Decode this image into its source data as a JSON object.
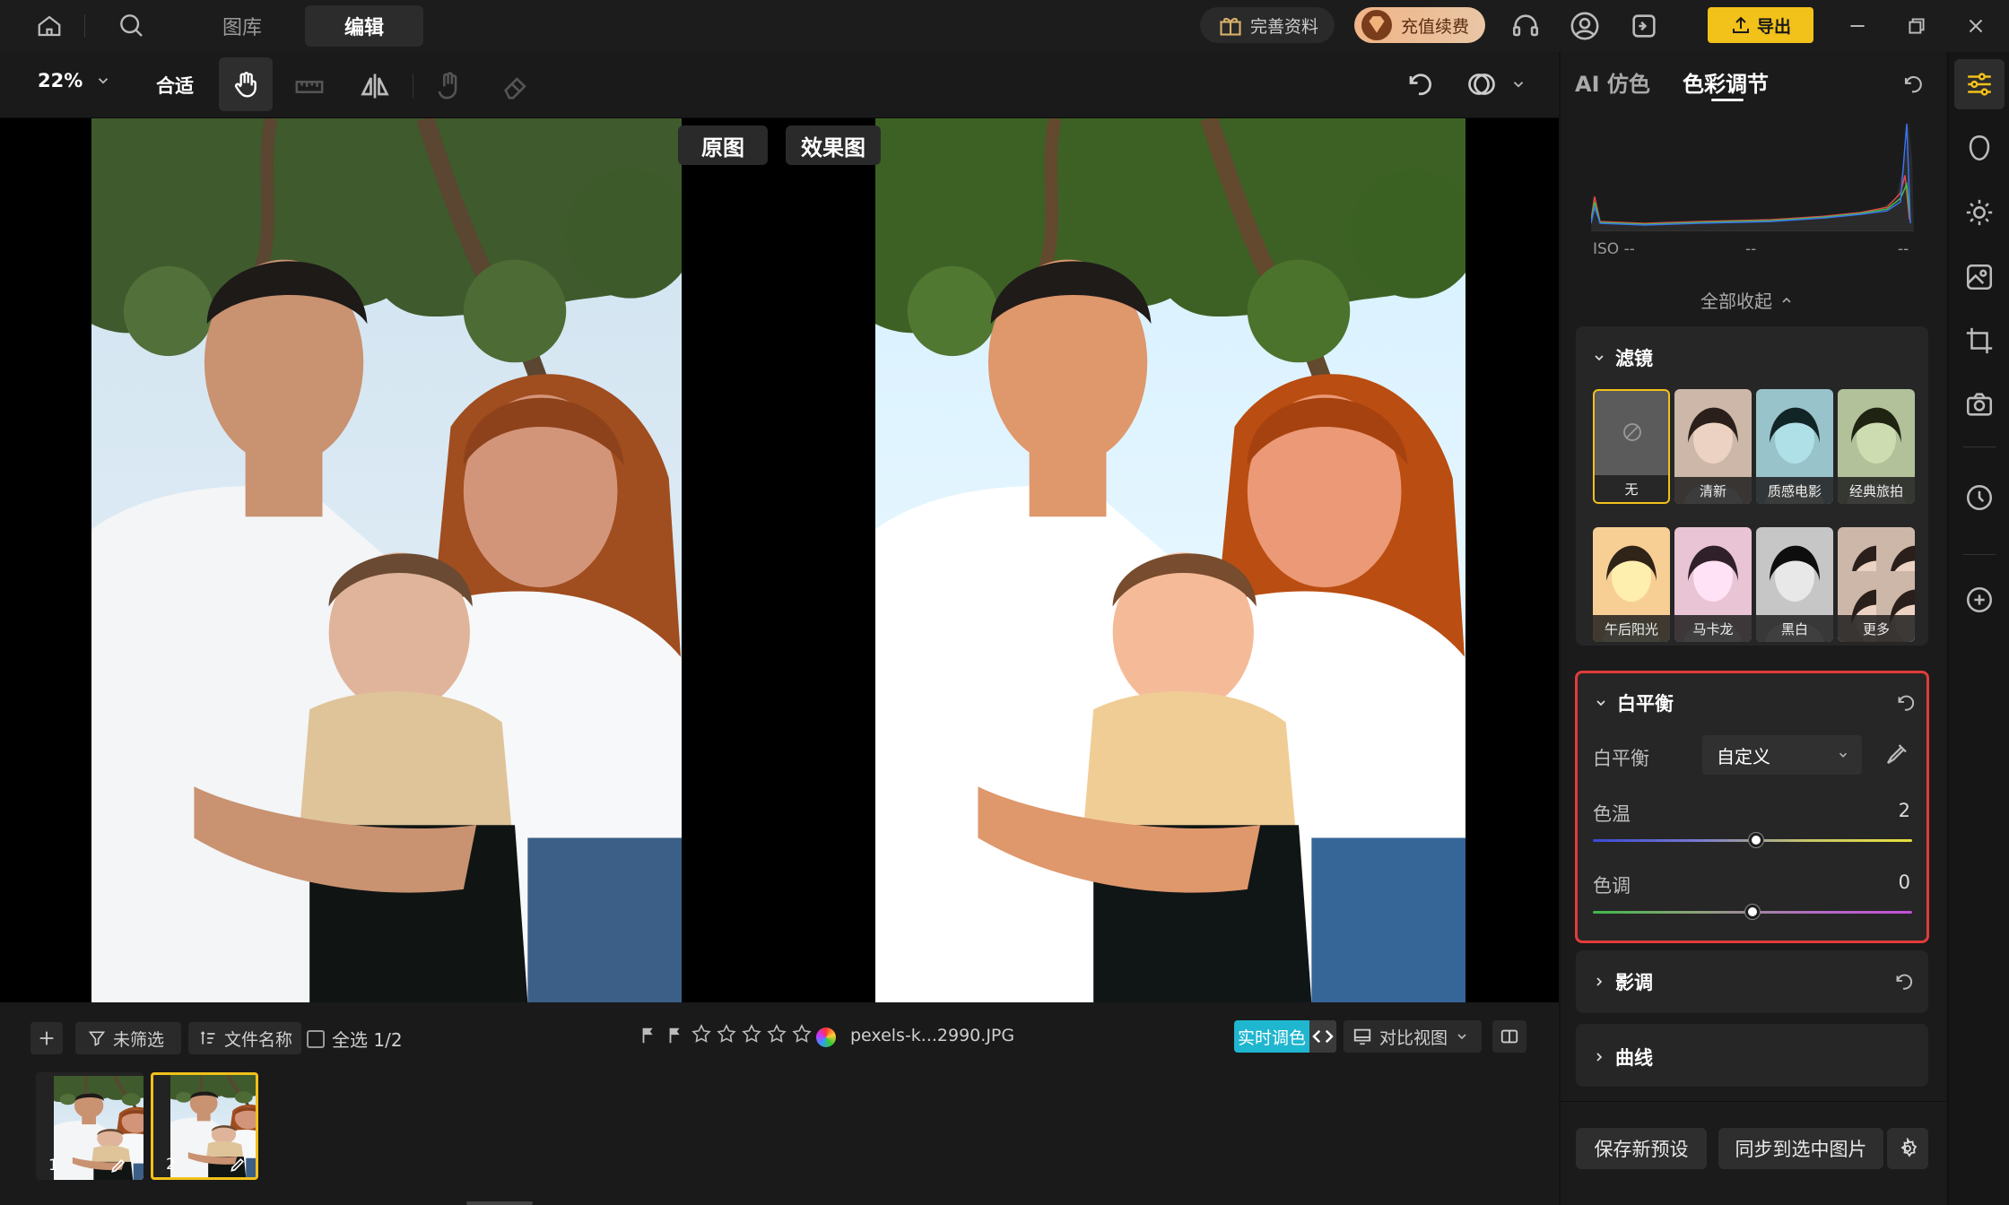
{
  "nav": {
    "tab_library": "图库",
    "tab_edit": "编辑",
    "complete_profile": "完善资料",
    "recharge": "充值续费",
    "export": "导出"
  },
  "toolbar": {
    "zoom": "22%",
    "fit": "合适"
  },
  "canvas": {
    "original_label": "原图",
    "effect_label": "效果图"
  },
  "filmstrip": {
    "filter": "未筛选",
    "sort": "文件名称",
    "select_all": "全选 1/2",
    "filename": "pexels-k...2990.JPG",
    "realtime": "实时调色",
    "compare_view": "对比视图",
    "thumbs": [
      {
        "index": "1"
      },
      {
        "index": "2"
      }
    ]
  },
  "panel": {
    "tab_ai": "AI 仿色",
    "tab_color": "色彩调节",
    "iso": "ISO --",
    "dash1": "--",
    "dash2": "--",
    "collapse_all": "全部收起",
    "filters": {
      "title": "滤镜",
      "items": [
        {
          "name": "无"
        },
        {
          "name": "清新"
        },
        {
          "name": "质感电影"
        },
        {
          "name": "经典旅拍"
        },
        {
          "name": "午后阳光"
        },
        {
          "name": "马卡龙"
        },
        {
          "name": "黑白"
        },
        {
          "name": "更多"
        }
      ]
    },
    "white_balance": {
      "title": "白平衡",
      "label": "白平衡",
      "mode": "自定义",
      "temp_label": "色温",
      "temp_value": "2",
      "temp_fraction": 0.51,
      "tint_label": "色调",
      "tint_value": "0",
      "tint_fraction": 0.5
    },
    "tone": {
      "title": "影调"
    },
    "curves": {
      "title": "曲线"
    },
    "save_preset": "保存新预设",
    "sync": "同步到选中图片"
  },
  "colors": {
    "accent": "#f2c11a",
    "highlight_border": "#e23b3b",
    "realtime": "#1fb6cf"
  }
}
